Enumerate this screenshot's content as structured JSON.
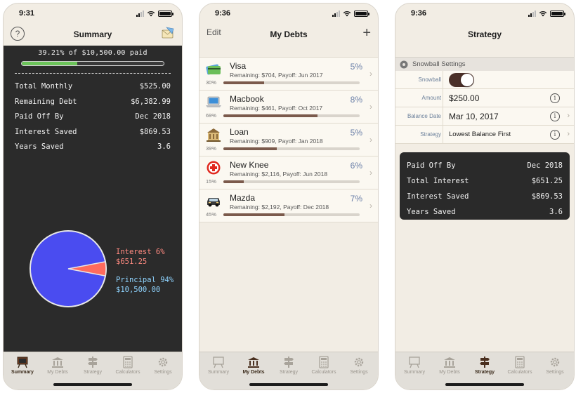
{
  "colors": {
    "chalk_bg": "#2b2b2b",
    "progress_green": "#6cc45a",
    "interest_red": "#ff6b5e",
    "principal_blue": "#4a4cf0",
    "accent_brown": "#4a2f28",
    "rate_blue": "#6a7fa8"
  },
  "tabs": [
    {
      "label": "Summary",
      "icon": "summary-icon"
    },
    {
      "label": "My Debts",
      "icon": "bank-icon"
    },
    {
      "label": "Strategy",
      "icon": "signpost-icon"
    },
    {
      "label": "Calculators",
      "icon": "calculator-icon"
    },
    {
      "label": "Settings",
      "icon": "gear-icon"
    }
  ],
  "screens": {
    "summary": {
      "time": "9:31",
      "title": "Summary",
      "paid_label": "39.21% of $10,500.00 paid",
      "paid_fraction": 0.3921,
      "stats": [
        {
          "label": "Total Monthly",
          "value": "$525.00"
        },
        {
          "label": "Remaining Debt",
          "value": "$6,382.99"
        },
        {
          "label": "Paid Off By",
          "value": "Dec 2018"
        },
        {
          "label": "Interest Saved",
          "value": "$869.53"
        },
        {
          "label": "Years Saved",
          "value": "3.6"
        }
      ],
      "pie": {
        "interest_label": "Interest 6%",
        "interest_value": "$651.25",
        "interest_fraction": 0.06,
        "principal_label": "Principal 94%",
        "principal_value": "$10,500.00",
        "principal_fraction": 0.94
      }
    },
    "debts": {
      "time": "9:36",
      "title": "My Debts",
      "edit_label": "Edit",
      "plus": "+",
      "items": [
        {
          "name": "Visa",
          "detail": "Remaining: $704, Payoff: Jun 2017",
          "rate": "5%",
          "paid_label": "30%",
          "paid": 0.3,
          "icon": "credit-card-icon"
        },
        {
          "name": "Macbook",
          "detail": "Remaining: $461, Payoff: Oct 2017",
          "rate": "8%",
          "paid_label": "69%",
          "paid": 0.69,
          "icon": "laptop-icon"
        },
        {
          "name": "Loan",
          "detail": "Remaining: $909, Payoff: Jan 2018",
          "rate": "5%",
          "paid_label": "39%",
          "paid": 0.39,
          "icon": "bank-building-icon"
        },
        {
          "name": "New Knee",
          "detail": "Remaining: $2,116, Payoff: Jun 2018",
          "rate": "6%",
          "paid_label": "15%",
          "paid": 0.15,
          "icon": "medical-cross-icon"
        },
        {
          "name": "Mazda",
          "detail": "Remaining: $2,192, Payoff: Dec 2018",
          "rate": "7%",
          "paid_label": "45%",
          "paid": 0.45,
          "icon": "car-icon"
        }
      ]
    },
    "strategy": {
      "time": "9:36",
      "title": "Strategy",
      "section": "Snowball Settings",
      "snowball_label": "Snowball",
      "snowball_on": true,
      "amount_label": "Amount",
      "amount_value": "$250.00",
      "balance_date_label": "Balance Date",
      "balance_date_value": "Mar 10, 2017",
      "strategy_label": "Strategy",
      "strategy_value": "Lowest Balance First",
      "results": [
        {
          "label": "Paid Off By",
          "value": "Dec 2018"
        },
        {
          "label": "Total Interest",
          "value": "$651.25"
        },
        {
          "label": "Interest Saved",
          "value": "$869.53"
        },
        {
          "label": "Years Saved",
          "value": "3.6"
        }
      ]
    }
  }
}
